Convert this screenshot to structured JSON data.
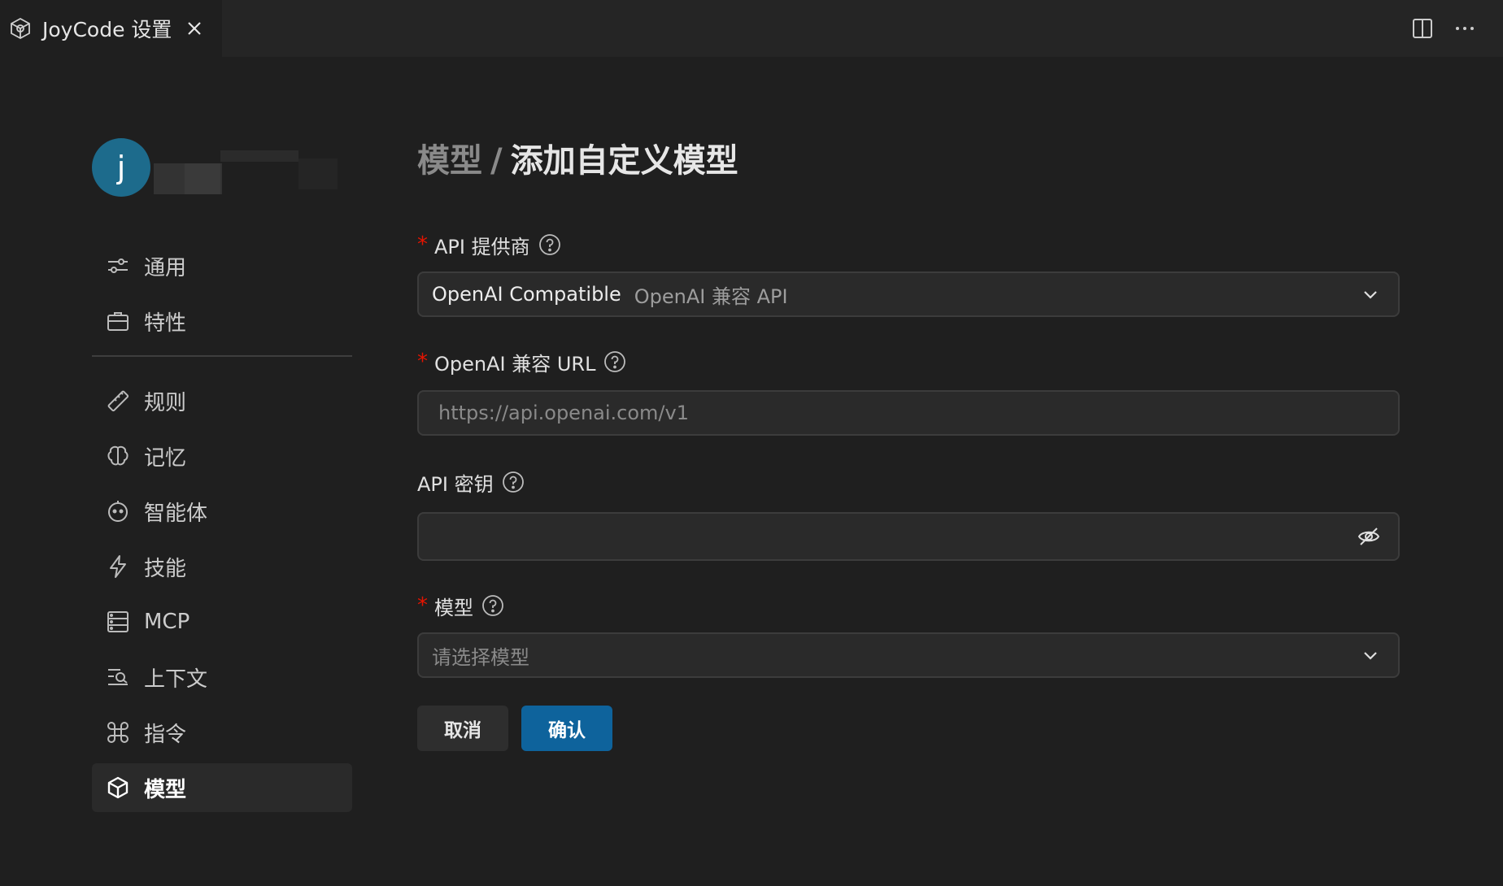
{
  "window": {
    "tab_title": "JoyCode 设置",
    "icons": [
      "joycode-logo-icon",
      "close-icon",
      "split-editor-icon",
      "more-icon"
    ]
  },
  "profile": {
    "avatar_letter": "j"
  },
  "sidebar": {
    "group1": [
      {
        "label": "通用",
        "icon": "sliders-icon"
      },
      {
        "label": "特性",
        "icon": "briefcase-icon"
      }
    ],
    "group2": [
      {
        "label": "规则",
        "icon": "ruler-icon"
      },
      {
        "label": "记忆",
        "icon": "brain-icon"
      },
      {
        "label": "智能体",
        "icon": "robot-icon"
      },
      {
        "label": "技能",
        "icon": "lightning-icon"
      },
      {
        "label": "MCP",
        "icon": "server-icon"
      },
      {
        "label": "上下文",
        "icon": "context-search-icon"
      },
      {
        "label": "指令",
        "icon": "command-icon"
      },
      {
        "label": "模型",
        "icon": "cube-icon",
        "active": true
      }
    ]
  },
  "main": {
    "breadcrumb": "模型",
    "separator": "/",
    "title": "添加自定义模型",
    "provider": {
      "label": "API 提供商",
      "value": "OpenAI Compatible",
      "value_desc": "OpenAI 兼容 API"
    },
    "url": {
      "label": "OpenAI 兼容 URL",
      "placeholder": "https://api.openai.com/v1"
    },
    "api_key": {
      "label": "API 密钥",
      "value": ""
    },
    "model": {
      "label": "模型",
      "placeholder": "请选择模型"
    },
    "required_mark": "*",
    "buttons": {
      "cancel": "取消",
      "confirm": "确认"
    }
  },
  "colors": {
    "background": "#1f1f1f",
    "accent": "#0e639c",
    "required": "#e51400",
    "avatar": "#1d6b8c"
  }
}
